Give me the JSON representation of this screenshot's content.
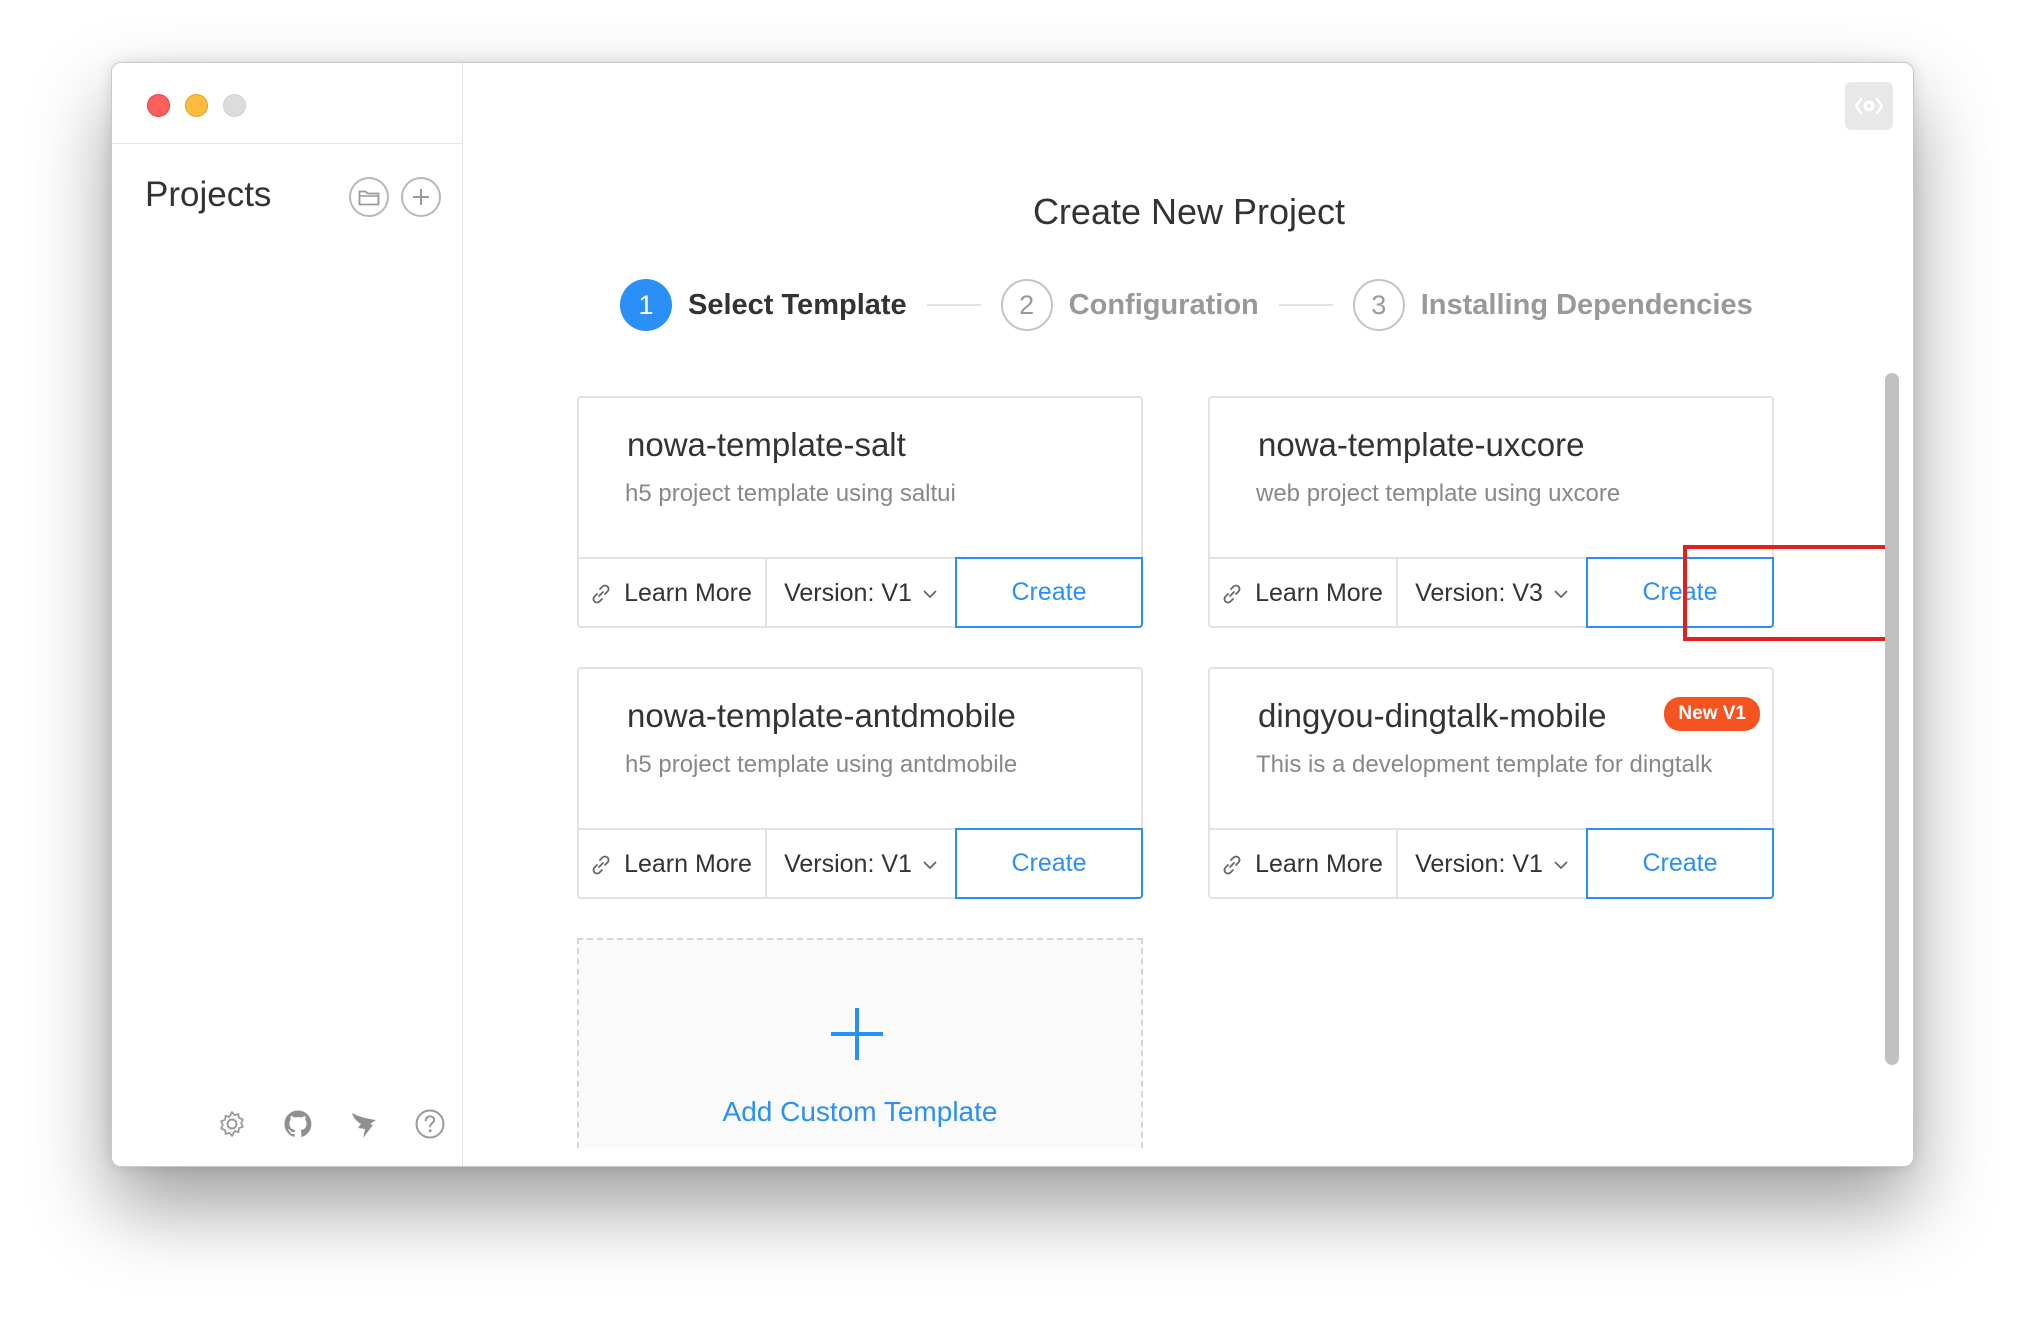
{
  "sidebar": {
    "title": "Projects",
    "icons": [
      "folder-icon",
      "plus-icon"
    ],
    "footer_icons": [
      "gear-icon",
      "github-icon",
      "bird-icon",
      "help-icon"
    ]
  },
  "main": {
    "title": "Create New Project",
    "steps": [
      {
        "number": "1",
        "label": "Select Template",
        "state": "active"
      },
      {
        "number": "2",
        "label": "Configuration",
        "state": "wait"
      },
      {
        "number": "3",
        "label": "Installing Dependencies",
        "state": "wait"
      }
    ],
    "templates": [
      {
        "name": "nowa-template-salt",
        "description": "h5 project template using saltui",
        "learn_more": "Learn More",
        "version": "Version: V1",
        "create": "Create",
        "badge": ""
      },
      {
        "name": "nowa-template-uxcore",
        "description": "web project template using uxcore",
        "learn_more": "Learn More",
        "version": "Version: V3",
        "create": "Create",
        "badge": ""
      },
      {
        "name": "nowa-template-antdmobile",
        "description": "h5 project template using antdmobile",
        "learn_more": "Learn More",
        "version": "Version: V1",
        "create": "Create",
        "badge": ""
      },
      {
        "name": "dingyou-dingtalk-mobile",
        "description": "This is a development template for dingtalk",
        "learn_more": "Learn More",
        "version": "Version: V1",
        "create": "Create",
        "badge": "New V1"
      }
    ],
    "add_custom": "Add Custom Template"
  },
  "colors": {
    "accent": "#2a8ff7",
    "badge": "#f5531f",
    "highlight": "#e3201b"
  }
}
